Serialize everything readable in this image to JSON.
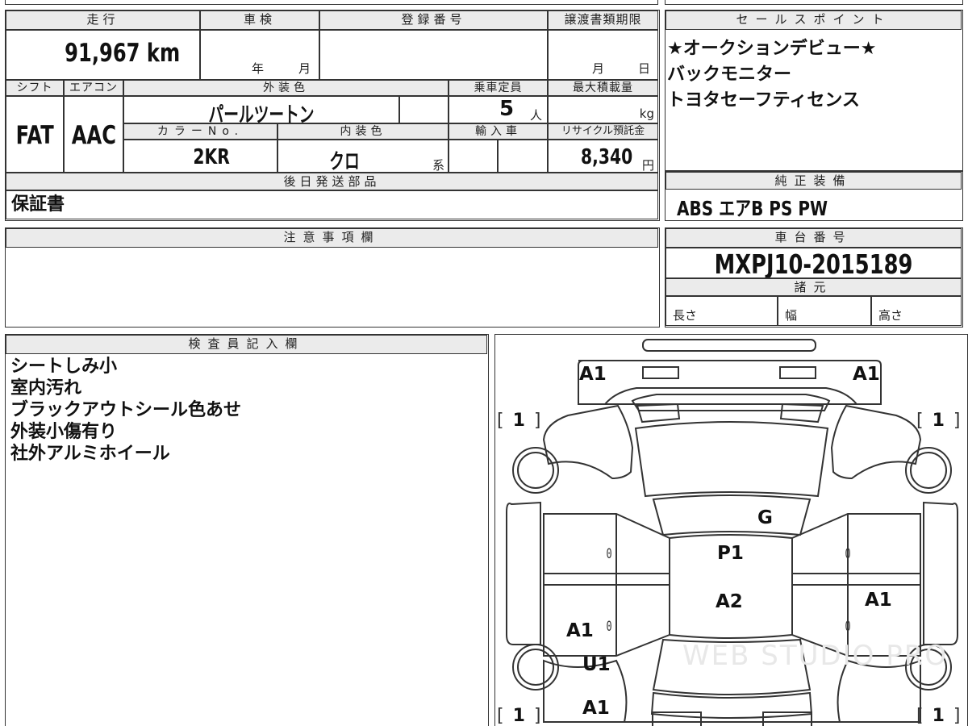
{
  "header": {
    "mileage_label": "走行",
    "inspection_label": "車検",
    "registration_label": "登録番号",
    "transfer_deadline_label": "譲渡書類期限",
    "shift_label": "シフト",
    "aircon_label": "エアコン",
    "exterior_color_label": "外装色",
    "capacity_label": "乗車定員",
    "max_load_label": "最大積載量",
    "color_no_label": "カラーNo.",
    "interior_color_label": "内装色",
    "import_label": "輸入車",
    "recycle_label": "リサイクル預託金",
    "later_parts_label": "後日発送部品",
    "notes_label": "注意事項欄",
    "inspector_label": "検査員記入欄",
    "sales_point_label": "セールスポイント",
    "standard_equipment_label": "純正装備",
    "chassis_label": "車台番号",
    "specs_label": "諸元"
  },
  "vehicle": {
    "mileage": "91,967 km",
    "inspection_year_unit": "年",
    "inspection_month_unit": "月",
    "transfer_month_unit": "月",
    "transfer_day_unit": "日",
    "shift": "FAT",
    "aircon": "AAC",
    "exterior_color": "パールツートン",
    "capacity": "5",
    "capacity_unit": "人",
    "max_load_unit": "kg",
    "color_no": "2KR",
    "interior_color": "クロ",
    "interior_color_suffix": "系",
    "recycle_fee": "8,340",
    "recycle_unit": "円",
    "later_parts": "保証書",
    "chassis_number": "MXPJ10-2015189",
    "length_label": "長さ",
    "width_label": "幅",
    "height_label": "高さ"
  },
  "sales_points": [
    "★オークションデビュー★",
    "バックモニター",
    "トヨタセーフティセンス"
  ],
  "standard_equipment": "ABS エアB PS PW",
  "inspector_notes": [
    "シートしみ小",
    "室内汚れ",
    "ブラックアウトシール色あせ",
    "外装小傷有り",
    "社外アルミホイール"
  ],
  "diagram": {
    "front_left": "A1",
    "front_right": "A1",
    "tire_front_left": "1",
    "tire_front_right": "1",
    "tire_rear_left": "1",
    "tire_rear_right": "1",
    "windshield": "G",
    "roof_front": "P1",
    "roof_rear": "A2",
    "right_rear_door": "A1",
    "left_rear_door": "A1",
    "left_rear_quarter": "U1",
    "rear_bumper": "A1",
    "zero_mark": "0",
    "watermark": "WEB STUDIO PRO"
  }
}
